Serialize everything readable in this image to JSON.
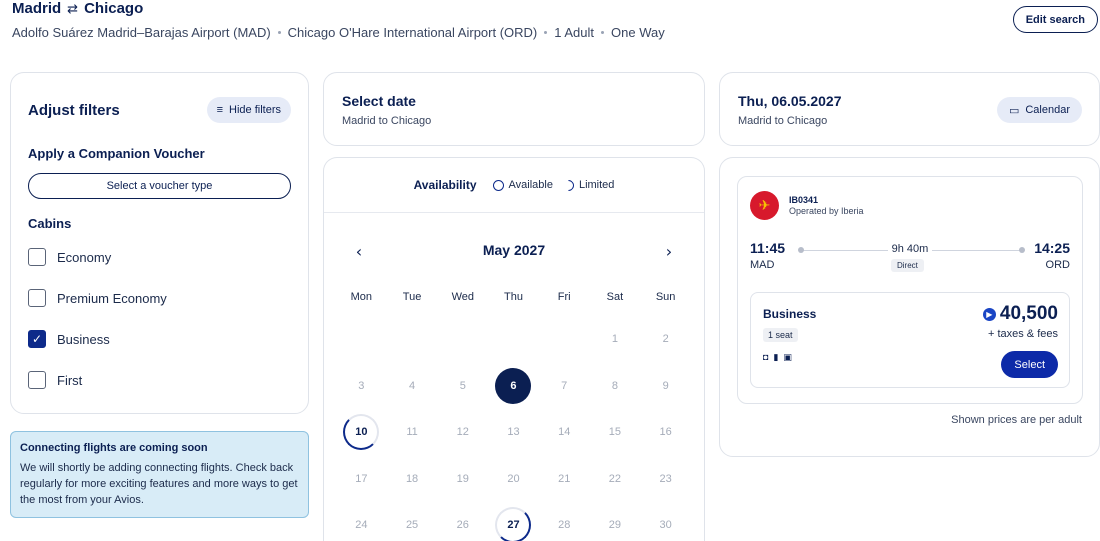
{
  "header": {
    "origin": "Madrid",
    "destination": "Chicago",
    "swap_icon": "⇄",
    "origin_airport": "Adolfo Suárez Madrid–Barajas Airport (MAD)",
    "destination_airport": "Chicago O'Hare International Airport (ORD)",
    "passengers": "1 Adult",
    "trip_type": "One Way",
    "edit_label": "Edit search"
  },
  "filters": {
    "title": "Adjust filters",
    "hide_label": "Hide filters",
    "hide_icon": "sliders-icon",
    "voucher_label": "Apply a Companion Voucher",
    "voucher_button": "Select a voucher type",
    "cabins_label": "Cabins",
    "cabins": [
      {
        "label": "Economy",
        "checked": false
      },
      {
        "label": "Premium Economy",
        "checked": false
      },
      {
        "label": "Business",
        "checked": true
      },
      {
        "label": "First",
        "checked": false
      }
    ]
  },
  "notice": {
    "title": "Connecting flights are coming soon",
    "body": "We will shortly be adding connecting flights. Check back regularly for more exciting features and more ways to get the most from your Avios."
  },
  "select_date": {
    "title": "Select date",
    "subtitle": "Madrid to Chicago"
  },
  "calendar": {
    "availability_label": "Availability",
    "legend_available": "Available",
    "legend_limited": "Limited",
    "prev_icon": "‹",
    "next_icon": "›",
    "month": "May 2027",
    "weekdays": [
      "Mon",
      "Tue",
      "Wed",
      "Thu",
      "Fri",
      "Sat",
      "Sun"
    ],
    "days": [
      {
        "d": "",
        "state": "empty"
      },
      {
        "d": "",
        "state": "empty"
      },
      {
        "d": "",
        "state": "empty"
      },
      {
        "d": "",
        "state": "empty"
      },
      {
        "d": "",
        "state": "empty"
      },
      {
        "d": "1",
        "state": "none"
      },
      {
        "d": "2",
        "state": "none"
      },
      {
        "d": "3",
        "state": "none"
      },
      {
        "d": "4",
        "state": "none"
      },
      {
        "d": "5",
        "state": "none"
      },
      {
        "d": "6",
        "state": "selected"
      },
      {
        "d": "7",
        "state": "none"
      },
      {
        "d": "8",
        "state": "none"
      },
      {
        "d": "9",
        "state": "none"
      },
      {
        "d": "10",
        "state": "avail"
      },
      {
        "d": "11",
        "state": "none"
      },
      {
        "d": "12",
        "state": "none"
      },
      {
        "d": "13",
        "state": "none"
      },
      {
        "d": "14",
        "state": "none"
      },
      {
        "d": "15",
        "state": "none"
      },
      {
        "d": "16",
        "state": "none"
      },
      {
        "d": "17",
        "state": "none"
      },
      {
        "d": "18",
        "state": "none"
      },
      {
        "d": "19",
        "state": "none"
      },
      {
        "d": "20",
        "state": "none"
      },
      {
        "d": "21",
        "state": "none"
      },
      {
        "d": "22",
        "state": "none"
      },
      {
        "d": "23",
        "state": "none"
      },
      {
        "d": "24",
        "state": "none"
      },
      {
        "d": "25",
        "state": "none"
      },
      {
        "d": "26",
        "state": "none"
      },
      {
        "d": "27",
        "state": "avail2"
      },
      {
        "d": "28",
        "state": "none"
      },
      {
        "d": "29",
        "state": "none"
      },
      {
        "d": "30",
        "state": "none"
      }
    ]
  },
  "date_card": {
    "title": "Thu, 06.05.2027",
    "subtitle": "Madrid to Chicago",
    "calendar_label": "Calendar"
  },
  "flight": {
    "logo_glyph": "✈",
    "number": "IB0341",
    "operated_by": "Operated by Iberia",
    "dep_time": "11:45",
    "dep_code": "MAD",
    "arr_time": "14:25",
    "arr_code": "ORD",
    "duration": "9h 40m",
    "stops": "Direct",
    "fare": {
      "cabin": "Business",
      "seats": "1 seat",
      "bag_icons": [
        "bag-icon",
        "suitcase-icon",
        "luggage-icon"
      ],
      "price": "40,500",
      "avios_glyph": "▶",
      "taxes": "+ taxes & fees",
      "select_label": "Select"
    },
    "price_note": "Shown prices are per adult"
  },
  "colors": {
    "navy": "#0b1f52",
    "accent": "#0d2aa8",
    "iberia_red": "#d7192c",
    "notice_bg": "#d8ecf7"
  }
}
